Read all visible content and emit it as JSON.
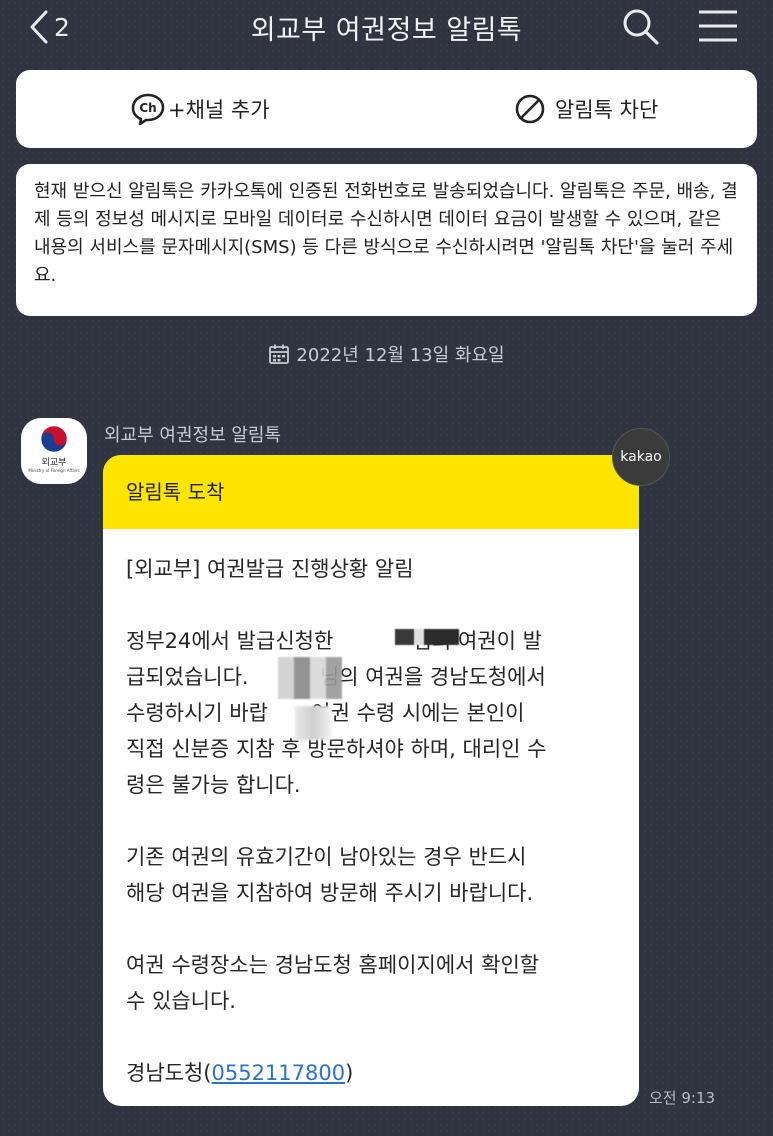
{
  "header": {
    "back_count": "2",
    "title": "외교부 여권정보 알림톡"
  },
  "actions": {
    "add_channel": "+채널 추가",
    "block": "알림톡 차단"
  },
  "notice": "현재 받으신 알림톡은 카카오톡에 인증된 전화번호로 발송되었습니다. 알림톡은 주문, 배송, 결제 등의 정보성 메시지로 모바일 데이터로 수신하시면 데이터 요금이 발생할 수 있으며, 같은 내용의 서비스를 문자메시지(SMS) 등 다른 방식으로 수신하시려면 '알림톡 차단'을 눌러 주세요.",
  "date": "2022년 12월 13일 화요일",
  "message": {
    "sender": "외교부 여권정보 알림톡",
    "avatar_label": "외교부",
    "avatar_sub": "Ministry of Foreign Affairs",
    "badge": "kakao",
    "header": "알림톡 도착",
    "title": "[외교부] 여권발급 진행상황 알림",
    "para1_line1_a": "정부24에서 발급신청한 ",
    "para1_line1_b": " 님의 여권이 발",
    "para1_line2_a": "급되었습니다. ",
    "para1_line2_b": " 님의 여권을 경남도청에서",
    "para1_line3_a": "수령하시기 바랍",
    "para1_line3_b": ". 여권 수령 시에는 본인이",
    "para1_line4": "직접 신분증 지참 후 방문하셔야 하며, 대리인 수",
    "para1_line5": "령은 불가능 합니다.",
    "para2_line1": "기존 여권의 유효기간이 남아있는 경우 반드시",
    "para2_line2": "해당 여권을 지참하여 방문해 주시기 바랍니다.",
    "para3_line1": "여권 수령장소는 경남도청 홈페이지에서 확인할",
    "para3_line2": " 수 있습니다.",
    "contact_prefix": "경남도청(",
    "contact_phone": "0552117800",
    "contact_suffix": ")",
    "time": "오전 9:13"
  }
}
